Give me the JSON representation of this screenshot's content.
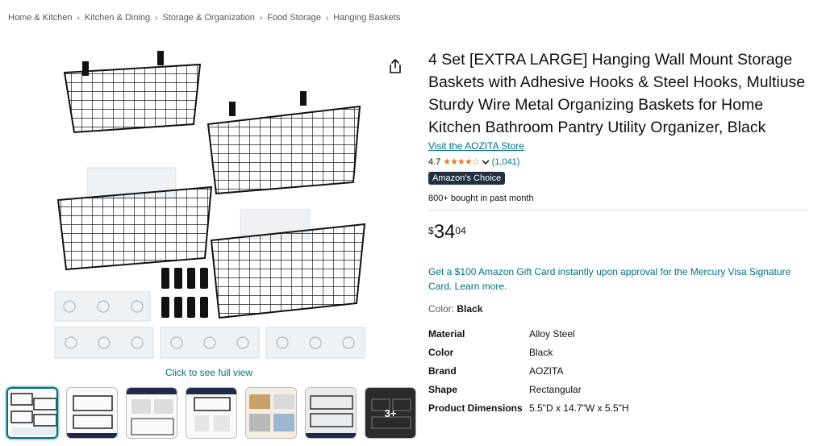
{
  "breadcrumb": [
    "Home & Kitchen",
    "Kitchen & Dining",
    "Storage & Organization",
    "Food Storage",
    "Hanging Baskets"
  ],
  "breadcrumb_separator": "›",
  "gallery": {
    "full_view_label": "Click to see full view",
    "more_thumbs_label": "3+"
  },
  "product": {
    "title": "4 Set [EXTRA LARGE] Hanging Wall Mount Storage Baskets with Adhesive Hooks & Steel Hooks, Multiuse Sturdy Wire Metal Organizing Baskets for Home Kitchen Bathroom Pantry Utility Organizer, Black",
    "store_link": "Visit the AOZITA Store",
    "rating": "4.7",
    "stars": "★★★★☆",
    "rating_count": "(1,041)",
    "badge": "Amazon's Choice",
    "bought": "800+ bought in past month",
    "price_symbol": "$",
    "price_whole": "34",
    "price_fraction": "04",
    "promo": "Get a $100 Amazon Gift Card instantly upon approval for the Mercury Visa Signature Card. Learn more.",
    "color_label": "Color:",
    "color_value": "Black"
  },
  "specs": [
    {
      "key": "Material",
      "value": "Alloy Steel"
    },
    {
      "key": "Color",
      "value": "Black"
    },
    {
      "key": "Brand",
      "value": "AOZITA"
    },
    {
      "key": "Shape",
      "value": "Rectangular"
    },
    {
      "key": "Product Dimensions",
      "value": "5.5\"D x 14.7\"W x 5.5\"H"
    }
  ],
  "colors": {
    "link": "#007185",
    "star": "#de7921",
    "badge_bg": "#232f3e"
  }
}
